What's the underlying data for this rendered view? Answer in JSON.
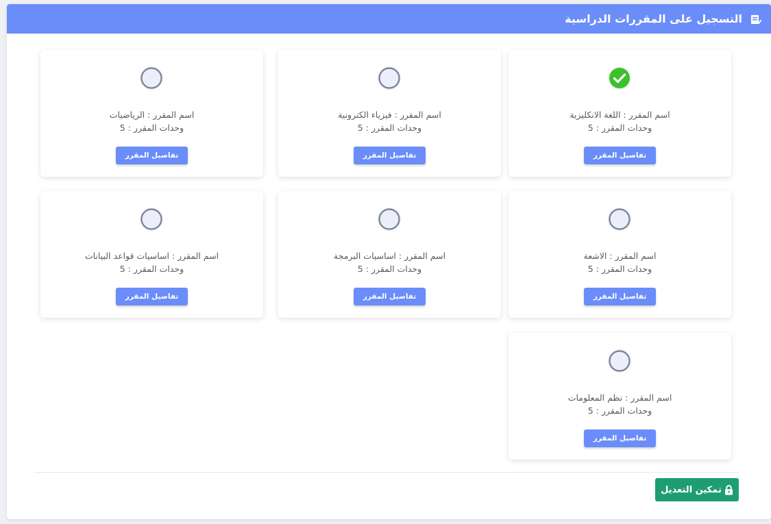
{
  "header": {
    "title": "التسجيل على المقررات الدراسية",
    "icon": "register-icon",
    "background": "#6a8df9"
  },
  "courses": [
    {
      "name": "اسم المقرر : اللغة الانكليزية",
      "units": "وحدات المقرر : 5",
      "button_label": "تفاصيل المقرر",
      "registered": true
    },
    {
      "name": "اسم المقرر : فيزياء الكترونية",
      "units": "وحدات المقرر : 5",
      "button_label": "تفاصيل المقرر",
      "registered": false
    },
    {
      "name": "اسم المقرر : الرياضيات",
      "units": "وحدات المقرر : 5",
      "button_label": "تفاصيل المقرر",
      "registered": false
    },
    {
      "name": "اسم المقرر : الاشعة",
      "units": "وحدات المقرر : 5",
      "button_label": "تفاصيل المقرر",
      "registered": false
    },
    {
      "name": "اسم المقرر : اساسيات البرمجة",
      "units": "وحدات المقرر : 5",
      "button_label": "تفاصيل المقرر",
      "registered": false
    },
    {
      "name": "اسم المقرر : اساسيات قواعد البيانات",
      "units": "وحدات المقرر : 5",
      "button_label": "تفاصيل المقرر",
      "registered": false
    },
    {
      "name": "اسم المقرر : نظم المعلومات",
      "units": "وحدات المقرر : 5",
      "button_label": "تفاصيل المقرر",
      "registered": false
    }
  ],
  "footer": {
    "enable_edit_label": "تمكين التعديل",
    "enable_edit_icon": "lock-icon",
    "enable_edit_color": "#1f9d72"
  },
  "colors": {
    "accent": "#6a8df9",
    "registered": "#3dbf2e",
    "unregistered_ring": "#7a8190"
  }
}
